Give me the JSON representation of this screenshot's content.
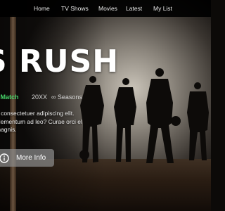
{
  "nav": {
    "items": [
      {
        "label": "Home"
      },
      {
        "label": "TV Shows"
      },
      {
        "label": "Movies"
      },
      {
        "label": "Latest"
      },
      {
        "label": "My List"
      }
    ]
  },
  "hero": {
    "title": "S RUSH",
    "match": "% Match",
    "year": "20XX",
    "seasons": "∞ Seasons",
    "description": "t, consectetuer adipiscing elit. elementum ad leo? Curae orci el magnis.",
    "more_info_label": "More Info",
    "icons": {
      "more_info": "info-icon"
    }
  },
  "colors": {
    "match_green": "#46d369",
    "nav_background": "#000000",
    "button_background": "#8c8c8c"
  }
}
